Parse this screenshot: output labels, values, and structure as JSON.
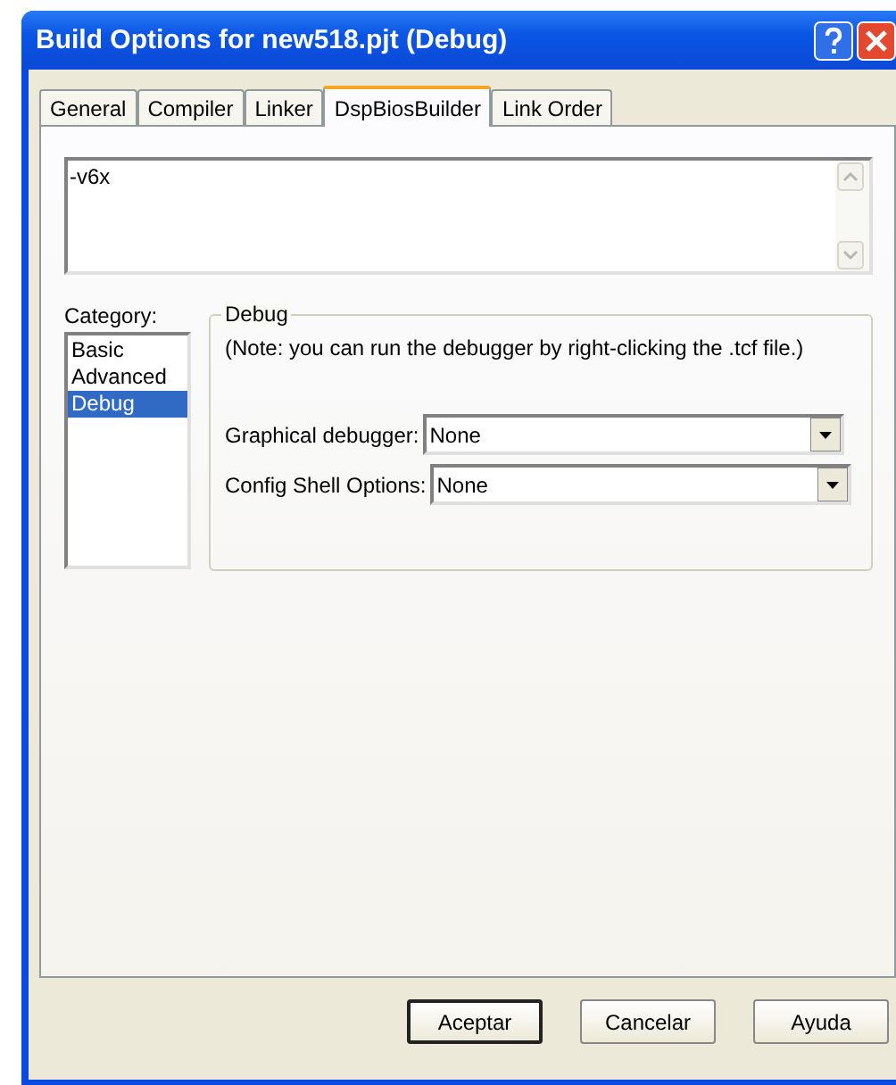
{
  "window": {
    "title": "Build Options for new518.pjt (Debug)"
  },
  "tabs": [
    {
      "label": "General",
      "selected": false
    },
    {
      "label": "Compiler",
      "selected": false
    },
    {
      "label": "Linker",
      "selected": false
    },
    {
      "label": "DspBiosBuilder",
      "selected": true
    },
    {
      "label": "Link Order",
      "selected": false
    }
  ],
  "options_text": "-v6x",
  "category": {
    "label": "Category:",
    "items": [
      {
        "label": "Basic",
        "selected": false
      },
      {
        "label": "Advanced",
        "selected": false
      },
      {
        "label": "Debug",
        "selected": true
      }
    ]
  },
  "group": {
    "title": "Debug",
    "note": "(Note: you can run the debugger by right-clicking the .tcf file.)",
    "fields": [
      {
        "label": "Graphical debugger:",
        "value": "None"
      },
      {
        "label": "Config Shell Options:",
        "value": "None"
      }
    ]
  },
  "buttons": [
    {
      "label": "Aceptar",
      "default": true
    },
    {
      "label": "Cancelar",
      "default": false
    },
    {
      "label": "Ayuda",
      "default": false
    }
  ]
}
